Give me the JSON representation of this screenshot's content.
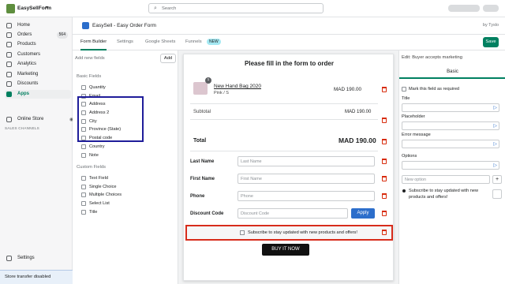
{
  "topbar": {
    "store_name": "EasySellForm",
    "search_placeholder": "Search"
  },
  "sidebar": {
    "items": [
      {
        "label": "Home"
      },
      {
        "label": "Orders",
        "badge": "564"
      },
      {
        "label": "Products"
      },
      {
        "label": "Customers"
      },
      {
        "label": "Analytics"
      },
      {
        "label": "Marketing"
      },
      {
        "label": "Discounts"
      },
      {
        "label": "Apps"
      }
    ],
    "sales_channels_label": "SALES CHANNELS",
    "online_store": "Online Store",
    "settings": "Settings",
    "transfer_notice": "Store transfer disabled"
  },
  "app": {
    "title": "EasySell - Easy Order Form",
    "by": "by Tyslo",
    "tabs": [
      "Form Builder",
      "Settings",
      "Google Sheets",
      "Funnels"
    ],
    "new_badge": "NEW",
    "save": "Save"
  },
  "left_panel": {
    "add_new_fields": "Add new fields",
    "add_button": "Add",
    "basic_header": "Basic Fields",
    "basic_fields": [
      "Quantity",
      "Email",
      "Address",
      "Address 2",
      "City",
      "Province (State)",
      "Postal code",
      "Country",
      "Note"
    ],
    "custom_header": "Custom Fields",
    "custom_fields": [
      "Text Field",
      "Single Choice",
      "Multiple Choices",
      "Select List",
      "Title"
    ]
  },
  "form": {
    "title": "Please fill in the form to order",
    "product": {
      "qty": "1",
      "name": "New Hand Bag 2020",
      "variant": "Pink / S",
      "price": "MAD 190.00"
    },
    "subtotal_label": "Subtotal",
    "subtotal_value": "MAD 190.00",
    "total_label": "Total",
    "total_value": "MAD 190.00",
    "fields": [
      {
        "label": "Last Name",
        "placeholder": "Last Name"
      },
      {
        "label": "First Name",
        "placeholder": "First Name"
      },
      {
        "label": "Phone",
        "placeholder": "Phone"
      },
      {
        "label": "Discount Code",
        "placeholder": "Discount Code"
      }
    ],
    "apply": "Apply",
    "subscribe": "Subscribe to stay updated with new products and offers!",
    "buy": "BUY IT NOW"
  },
  "right_panel": {
    "title": "Edit: Buyer accepts marketing",
    "tab": "Basic",
    "required_label": "Mark this field as required",
    "title_label": "Title",
    "placeholder_label": "Placeholder",
    "error_label": "Error message",
    "options_label": "Options",
    "new_option_placeholder": "New option",
    "option_value": "Subscribe to stay updated with new products and offers!"
  }
}
